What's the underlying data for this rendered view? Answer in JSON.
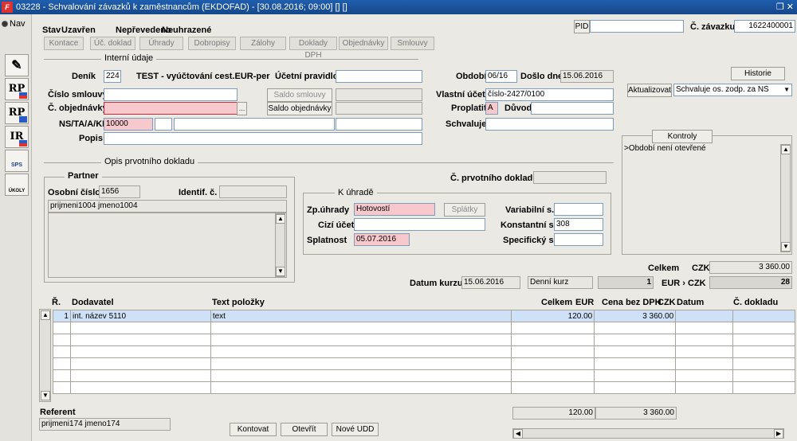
{
  "window": {
    "title": "03228 - Schvalování závazků k zaměstnancům (EKDOFAD) - [30.08.2016; 09:00] [] []",
    "restore_icon": "restore-icon",
    "close_icon": "close-icon"
  },
  "nav": {
    "radio_label": "Nav",
    "buttons": [
      {
        "label": "RP"
      },
      {
        "label": "RP"
      },
      {
        "label": "IR"
      },
      {
        "label": "SPS"
      },
      {
        "label": "ÚKOLY"
      }
    ]
  },
  "header": {
    "stav_label": "Stav",
    "stav_value": "Uzavřen",
    "status_1": "Nepřevedeno",
    "status_2": "Neuhrazené",
    "pid_label": "PID",
    "pid_value": "",
    "zavazek_label": "Č. závazku",
    "zavazek_value": "1622400001"
  },
  "tabs": [
    "Kontace",
    "Úč. doklad",
    "Úhrady",
    "Dobropisy",
    "Zálohy",
    "Doklady DPH",
    "Objednávky",
    "Smlouvy"
  ],
  "internal": {
    "section_title": "Interní údaje",
    "denik_label": "Deník",
    "denik_value": "224",
    "denik_desc": "TEST - vyúčtování cest.EUR-per diem",
    "ucetni_pravidlo_label": "Účetní pravidlo",
    "ucetni_pravidlo_value": "",
    "cislo_smlouvy_label": "Číslo smlouvy",
    "cislo_smlouvy_value": "",
    "saldo_smlouvy_label": "Saldo smlouvy",
    "objednavky_label": "Č. objednávky",
    "objednavky_value": "",
    "saldo_objednavky_label": "Saldo objednávky",
    "ns_label": "NS/TA/A/KP",
    "ns_value": "10000",
    "popis_label": "Popis",
    "popis_value": "",
    "obdobi_label": "Období",
    "obdobi_value": "06/16",
    "doslo_label": "Došlo dne",
    "doslo_value": "15.06.2016",
    "vlastni_ucet_label": "Vlastní účet",
    "vlastni_ucet_value": "číslo-2427/0100",
    "proplatit_label": "Proplatit",
    "proplatit_value": "A",
    "duvod_label": "Důvod",
    "duvod_value": "",
    "schvaluje_label": "Schvaluje",
    "schvaluje_value": ""
  },
  "right_panel": {
    "historie_label": "Historie",
    "aktualizovat_label": "Aktualizovat",
    "schvaluje_select": "Schvaluje os. zodp. za NS",
    "kontroly_label": "Kontroly",
    "kontroly_text": ">Období není otevřené"
  },
  "opis": {
    "section_title": "Opis prvotního dokladu",
    "partner_title": "Partner",
    "osobni_cislo_label": "Osobní číslo",
    "osobni_cislo_value": "1656",
    "identif_label": "Identif. č.",
    "identif_value": "",
    "partner_name": "prijmeni1004 jmeno1004",
    "prvotni_label": "Č. prvotního dokladu",
    "prvotni_value": "",
    "k_uhrade_title": "K úhradě",
    "zp_uhrady_label": "Zp.úhrady",
    "zp_uhrady_value": "Hotovostí",
    "splatky_label": "Splátky",
    "cizi_ucet_label": "Cizí účet",
    "cizi_ucet_value": "",
    "splatnost_label": "Splatnost",
    "splatnost_value": "05.07.2016",
    "variabilni_label": "Variabilní s.",
    "variabilni_value": "",
    "konstantni_label": "Konstantní s.",
    "konstantni_value": "308",
    "specificky_label": "Specifický s.",
    "specificky_value": ""
  },
  "totals": {
    "celkem_label": "Celkem",
    "celkem_currency": "CZK",
    "celkem_value": "3 360.00",
    "datum_kurzu_label": "Datum kurzu",
    "datum_kurzu_value": "15.06.2016",
    "denni_kurz": "Denní kurz",
    "kurz_1": "1",
    "eur_czk_label": "EUR › CZK",
    "kurz_28": "28"
  },
  "items": {
    "headers": {
      "r": "Ř.",
      "dodavatel": "Dodavatel",
      "text": "Text položky",
      "celkem": "Celkem",
      "celkem_cur": "EUR",
      "cena": "Cena bez DPH",
      "cena_cur": "CZK",
      "datum": "Datum",
      "doklad": "Č. dokladu"
    },
    "rows": [
      {
        "r": "1",
        "dodavatel": "int. název 5110",
        "text": "text",
        "celkem": "120.00",
        "cena": "3 360.00",
        "datum": "",
        "doklad": ""
      }
    ],
    "sum_celkem": "120.00",
    "sum_cena": "3 360.00"
  },
  "footer": {
    "referent_label": "Referent",
    "referent_value": "prijmeni174 jmeno174",
    "kontovat_label": "Kontovat",
    "otevrit_label": "Otevřít",
    "nove_udd_label": "Nové UDD"
  }
}
